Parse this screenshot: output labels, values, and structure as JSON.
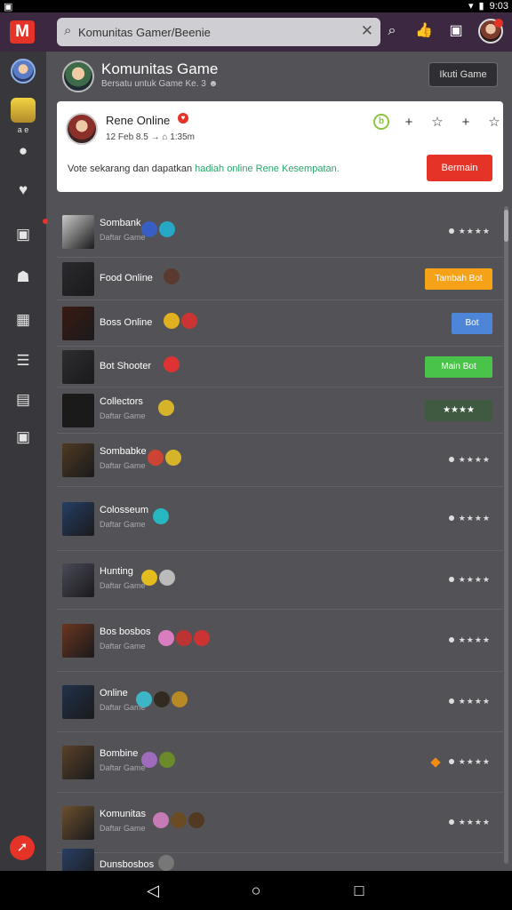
{
  "status": {
    "left_icon": "notification-icon",
    "time": "9:03"
  },
  "topbar": {
    "logo": "M",
    "search_placeholder": "Komunitas Gamer/Beenie",
    "search_value": "Komunitas Gamer/Beenie",
    "icons": [
      "search-icon",
      "thumbs-up-icon",
      "chat-icon",
      "profile-avatar"
    ]
  },
  "rail": {
    "items": [
      "avatar",
      "character",
      "alert-icon",
      "heart-icon",
      "controller-icon",
      "user-icon",
      "grid-icon",
      "list-icon",
      "gift-icon",
      "box-icon"
    ],
    "char_label": "a e"
  },
  "header": {
    "title": "Komunitas Game",
    "subtitle": "Bersatu untuk Game Ke. 3 ☻",
    "button": "Ikuti Game"
  },
  "card": {
    "name": "Rene Online",
    "meta": "12 Feb 8.5 → ⌂ 1:35m",
    "message_prefix": "Vote sekarang dan dapatkan ",
    "message_highlight": "hadiah online Rene Kesempatan.",
    "button": "Bermain",
    "icons": [
      "b",
      "+",
      "☆",
      "+",
      "☆"
    ]
  },
  "rows": [
    {
      "name": "Sombank",
      "sub": "Daftar Game",
      "rating": "★★★★",
      "thumb": "#c9c9c9",
      "badges": [
        "#3a5fc4",
        "#27a7c6"
      ]
    },
    {
      "name": "Food Online",
      "sub": "",
      "button": "Tambah Bot",
      "btn_color": "#f5a219",
      "thumb": "#2a2a2e",
      "badges": [
        "#5a3a2e"
      ]
    },
    {
      "name": "Boss Online",
      "sub": "",
      "button": "Bot",
      "btn_color": "#4d86d8",
      "thumb": "#3a1a12",
      "badges": [
        "#e0b020",
        "#c33"
      ]
    },
    {
      "name": "Bot Shooter",
      "sub": "",
      "button": "Main Bot",
      "btn_color": "#49c34a",
      "thumb": "#2d2d30",
      "badges": [
        "#d33"
      ]
    },
    {
      "name": "Collectors",
      "sub": "Daftar Game",
      "button": "★★★★",
      "btn_color": "#3f5a41",
      "thumb": "#1c1a18",
      "badges": [
        "#d6b42a"
      ]
    },
    {
      "name": "Sombabke",
      "sub": "Daftar Game",
      "rating": "★★★★",
      "thumb": "#4e3a22",
      "badges": [
        "#c43",
        "#d6b42a"
      ]
    },
    {
      "name": "Colosseum",
      "sub": "Daftar Game",
      "rating": "★★★★",
      "thumb": "#263e63",
      "badges": [
        "#26b7c0"
      ]
    },
    {
      "name": "Hunting",
      "sub": "Daftar Game",
      "rating": "★★★★",
      "thumb": "#4a4a57",
      "badges": [
        "#e3bd1e",
        "#bbb"
      ]
    },
    {
      "name": "Bos bosbos",
      "sub": "Daftar Game",
      "rating": "★★★★",
      "thumb": "#6a3520",
      "badges": [
        "#d87ec0",
        "#b33",
        "#c33"
      ]
    },
    {
      "name": "Online",
      "sub": "Daftar Game",
      "rating": "★★★★",
      "thumb": "#22314a",
      "badges": [
        "#3cb6c7",
        "#332b21",
        "#b88a26"
      ]
    },
    {
      "name": "Bombine",
      "sub": "Daftar Game",
      "rating": "★★★★",
      "thumb": "#5a4129",
      "badges": [
        "#9e6bbd",
        "#6b8a2a"
      ]
    },
    {
      "name": "Komunitas",
      "sub": "Daftar Game",
      "rating": "★★★★",
      "thumb": "#6b4f2e",
      "badges": [
        "#c47bb6",
        "#6b4b23",
        "#523a22"
      ]
    },
    {
      "name": "Dunsbosbos",
      "sub": "",
      "rating": "",
      "thumb": "#2a3f63",
      "badges": [
        "#777"
      ]
    }
  ],
  "nav": {
    "back": "◁",
    "home": "○",
    "recent": "□"
  }
}
